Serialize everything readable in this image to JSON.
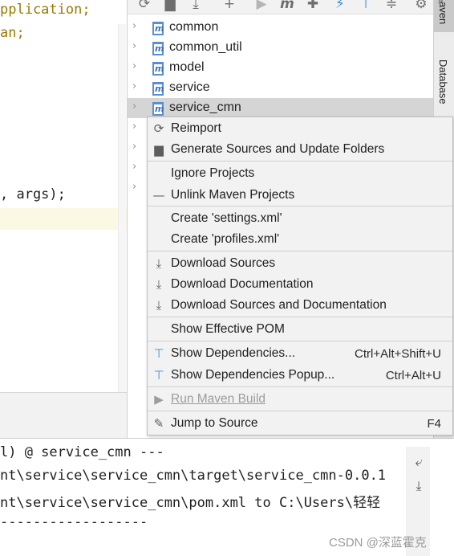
{
  "editor": {
    "lines": [
      "pplication;",
      "an;",
      ", args);"
    ]
  },
  "maven": {
    "tree": [
      {
        "label": "common"
      },
      {
        "label": "common_util"
      },
      {
        "label": "model"
      },
      {
        "label": "service"
      },
      {
        "label": "service_cmn",
        "selected": true
      }
    ],
    "side_tabs": {
      "maven": "aven",
      "database": "Database",
      "more": "»"
    }
  },
  "menu": {
    "items": [
      {
        "label": "Reimport",
        "icon": "refresh-icon"
      },
      {
        "label": "Generate Sources and Update Folders",
        "icon": "folder-refresh-icon"
      },
      {
        "label": "Ignore Projects",
        "icon": ""
      },
      {
        "label": "Unlink Maven Projects",
        "icon": "minus-icon"
      },
      {
        "label": "Create 'settings.xml'",
        "icon": ""
      },
      {
        "label": "Create 'profiles.xml'",
        "icon": ""
      },
      {
        "label": "Download Sources",
        "icon": "download-icon"
      },
      {
        "label": "Download Documentation",
        "icon": "download-icon"
      },
      {
        "label": "Download Sources and Documentation",
        "icon": "download-icon"
      },
      {
        "label": "Show Effective POM",
        "icon": ""
      },
      {
        "label": "Show Dependencies...",
        "icon": "dependencies-icon",
        "shortcut": "Ctrl+Alt+Shift+U"
      },
      {
        "label": "Show Dependencies Popup...",
        "icon": "dependencies-icon",
        "shortcut": "Ctrl+Alt+U"
      },
      {
        "label": "Run Maven Build",
        "icon": "run-icon",
        "disabled": true
      },
      {
        "label": "Jump to Source",
        "icon": "edit-icon",
        "shortcut": "F4"
      }
    ]
  },
  "console": {
    "lines": [
      "l) @ service_cmn ---",
      "nt\\service\\service_cmn\\target\\service_cmn-0.0.1",
      "nt\\service\\service_cmn\\pom.xml to C:\\Users\\轻轻",
      "------------------"
    ],
    "watermark": "CSDN @深蓝霍克"
  },
  "colors": {
    "editor_keyword": "#9a7a00",
    "selection": "#d5d5d5",
    "menu_bg": "#f2f2f2",
    "accent_blue": "#3a8fd6"
  }
}
